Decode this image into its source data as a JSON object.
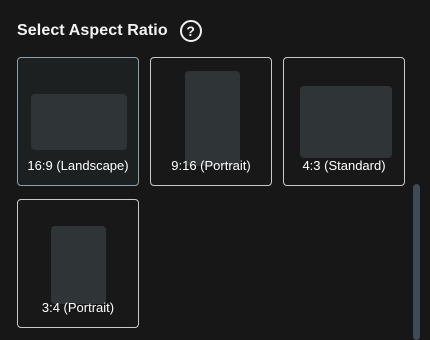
{
  "header": {
    "title": "Select Aspect Ratio",
    "help_icon": "question-circle-icon",
    "help_glyph": "?"
  },
  "options": [
    {
      "label": "16:9 (Landscape)",
      "selected": true
    },
    {
      "label": "9:16 (Portrait)",
      "selected": false
    },
    {
      "label": "4:3 (Standard)",
      "selected": false
    },
    {
      "label": "3:4 (Portrait)",
      "selected": false
    }
  ],
  "colors": {
    "background": "#171717",
    "selected_border": "#8aa0ae",
    "card_border": "#c9c9c9",
    "preview_fill": "#2f3436",
    "scrollbar_thumb": "#3c4b55"
  }
}
